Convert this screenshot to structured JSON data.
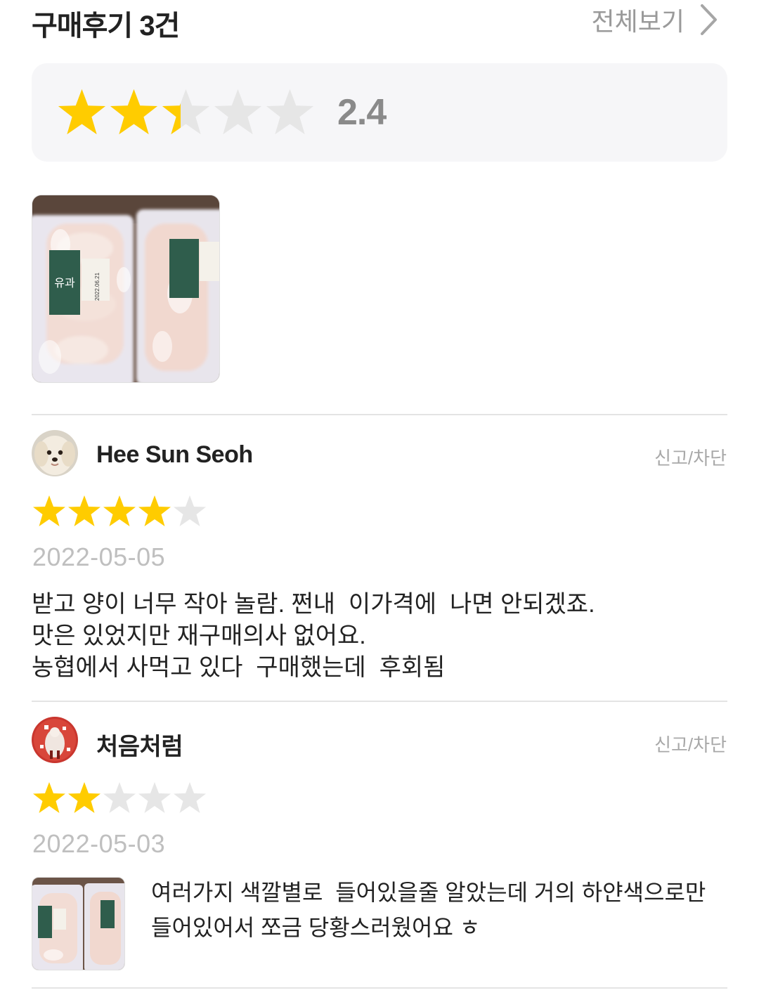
{
  "header": {
    "title": "구매후기 3건",
    "view_all_label": "전체보기",
    "view_all_icon": "chevron-right-icon"
  },
  "summary": {
    "rating": "2.4",
    "stars_total": 5,
    "stars_filled_fraction": 0.48,
    "star_icon": "star-icon"
  },
  "product_image": {
    "label_text": "유과",
    "date_stamp": "2022.06.21"
  },
  "reviews": [
    {
      "user": "Hee Sun Seoh",
      "avatar_icon": "dog-avatar-icon",
      "report_label": "신고/차단",
      "rating": 4,
      "date": "2022-05-05",
      "body_lines": [
        "받고 양이 너무 작아 놀람. 쩐내  이가격에  나면 안되겠죠.",
        "맛은 있었지만 재구매의사 없어요.",
        "농협에서 사먹고 있다  구매했는데  후회됨"
      ]
    },
    {
      "user": "처음처럼",
      "avatar_icon": "red-holiday-avatar-icon",
      "report_label": "신고/차단",
      "rating": 2,
      "date": "2022-05-03",
      "photo_icon": "review-photo-thumbnail",
      "body_lines": [
        "여러가지 색깔별로  들어있을줄 알았는데 거의 하얀색으로만",
        "들어있어서 쪼금 당황스러웠어요 ㅎ"
      ]
    }
  ],
  "colors": {
    "star_filled": "#ffcc00",
    "star_empty": "#e6e6e6",
    "panel_bg": "#f6f6f8",
    "divider": "#e4e4e4",
    "muted_text": "#9a9a9a",
    "date_text": "#bfbfbf"
  }
}
